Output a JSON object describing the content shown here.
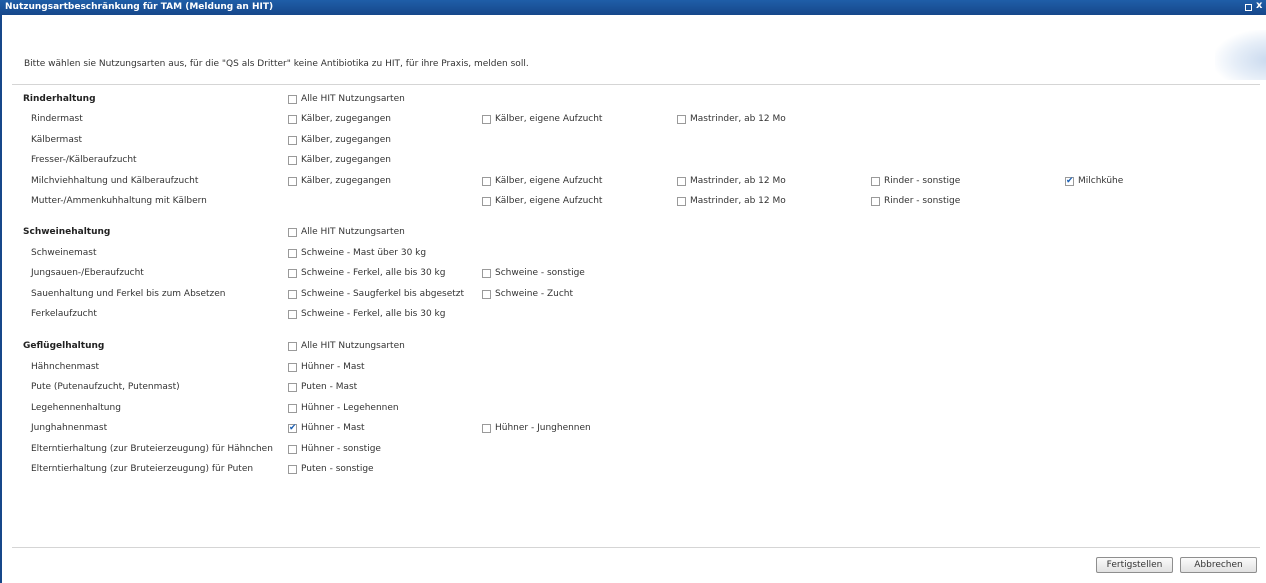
{
  "window": {
    "title": "Nutzungsartbeschränkung für TAM (Meldung an HIT)",
    "max_icon": "maximize-icon",
    "close_label": "x"
  },
  "intro": "Bitte wählen sie Nutzungsarten aus, für die \"QS als Dritter\" keine Antibiotika zu HIT, für ihre Praxis, melden soll.",
  "rows": [
    {
      "label": "Rinderhaltung",
      "group": true,
      "options": [
        {
          "col": 0,
          "label": "Alle HIT Nutzungsarten",
          "checked": false
        }
      ]
    },
    {
      "label": "Rindermast",
      "group": false,
      "options": [
        {
          "col": 0,
          "label": "Kälber, zugegangen",
          "checked": false
        },
        {
          "col": 1,
          "label": "Kälber, eigene Aufzucht",
          "checked": false
        },
        {
          "col": 2,
          "label": "Mastrinder, ab 12 Mo",
          "checked": false
        }
      ]
    },
    {
      "label": "Kälbermast",
      "group": false,
      "options": [
        {
          "col": 0,
          "label": "Kälber, zugegangen",
          "checked": false
        }
      ]
    },
    {
      "label": "Fresser-/Kälberaufzucht",
      "group": false,
      "options": [
        {
          "col": 0,
          "label": "Kälber, zugegangen",
          "checked": false
        }
      ]
    },
    {
      "label": "Milchviehhaltung und Kälberaufzucht",
      "group": false,
      "options": [
        {
          "col": 0,
          "label": "Kälber, zugegangen",
          "checked": false
        },
        {
          "col": 1,
          "label": "Kälber, eigene Aufzucht",
          "checked": false
        },
        {
          "col": 2,
          "label": "Mastrinder, ab 12 Mo",
          "checked": false
        },
        {
          "col": 3,
          "label": "Rinder - sonstige",
          "checked": false
        },
        {
          "col": 4,
          "label": "Milchkühe",
          "checked": true
        }
      ]
    },
    {
      "label": "Mutter-/Ammenkuhhaltung mit Kälbern",
      "group": false,
      "options": [
        {
          "col": 1,
          "label": "Kälber, eigene Aufzucht",
          "checked": false
        },
        {
          "col": 2,
          "label": "Mastrinder, ab 12 Mo",
          "checked": false
        },
        {
          "col": 3,
          "label": "Rinder - sonstige",
          "checked": false
        }
      ]
    },
    {
      "label": "Schweinehaltung",
      "group": true,
      "options": [
        {
          "col": 0,
          "label": "Alle HIT Nutzungsarten",
          "checked": false
        }
      ]
    },
    {
      "label": "Schweinemast",
      "group": false,
      "options": [
        {
          "col": 0,
          "label": "Schweine - Mast über 30 kg",
          "checked": false
        }
      ]
    },
    {
      "label": "Jungsauen-/Eberaufzucht",
      "group": false,
      "options": [
        {
          "col": 0,
          "label": "Schweine - Ferkel, alle bis 30 kg",
          "checked": false
        },
        {
          "col": 1,
          "label": "Schweine - sonstige",
          "checked": false
        }
      ]
    },
    {
      "label": "Sauenhaltung und Ferkel bis zum Absetzen",
      "group": false,
      "options": [
        {
          "col": 0,
          "label": "Schweine - Saugferkel bis abgesetzt",
          "checked": false
        },
        {
          "col": 1,
          "label": "Schweine - Zucht",
          "checked": false
        }
      ]
    },
    {
      "label": "Ferkelaufzucht",
      "group": false,
      "options": [
        {
          "col": 0,
          "label": "Schweine - Ferkel, alle bis 30 kg",
          "checked": false
        }
      ]
    },
    {
      "label": "Geflügelhaltung",
      "group": true,
      "options": [
        {
          "col": 0,
          "label": "Alle HIT Nutzungsarten",
          "checked": false
        }
      ]
    },
    {
      "label": "Hähnchenmast",
      "group": false,
      "options": [
        {
          "col": 0,
          "label": "Hühner - Mast",
          "checked": false
        }
      ]
    },
    {
      "label": "Pute (Putenaufzucht, Putenmast)",
      "group": false,
      "options": [
        {
          "col": 0,
          "label": "Puten - Mast",
          "checked": false
        }
      ]
    },
    {
      "label": "Legehennenhaltung",
      "group": false,
      "options": [
        {
          "col": 0,
          "label": "Hühner - Legehennen",
          "checked": false
        }
      ]
    },
    {
      "label": "Junghahnenmast",
      "group": false,
      "options": [
        {
          "col": 0,
          "label": "Hühner - Mast",
          "checked": true
        },
        {
          "col": 1,
          "label": "Hühner - Junghennen",
          "checked": false
        }
      ]
    },
    {
      "label": "Elterntierhaltung (zur Bruteierzeugung) für Hähnchen",
      "group": false,
      "options": [
        {
          "col": 0,
          "label": "Hühner - sonstige",
          "checked": false
        }
      ]
    },
    {
      "label": "Elterntierhaltung (zur Bruteierzeugung) für Puten",
      "group": false,
      "options": [
        {
          "col": 0,
          "label": "Puten - sonstige",
          "checked": false
        }
      ]
    }
  ],
  "buttons": {
    "finish": "Fertigstellen",
    "cancel": "Abbrechen"
  },
  "colors": {
    "titlebar": "#1a4f96",
    "check": "#1a5fb4"
  }
}
